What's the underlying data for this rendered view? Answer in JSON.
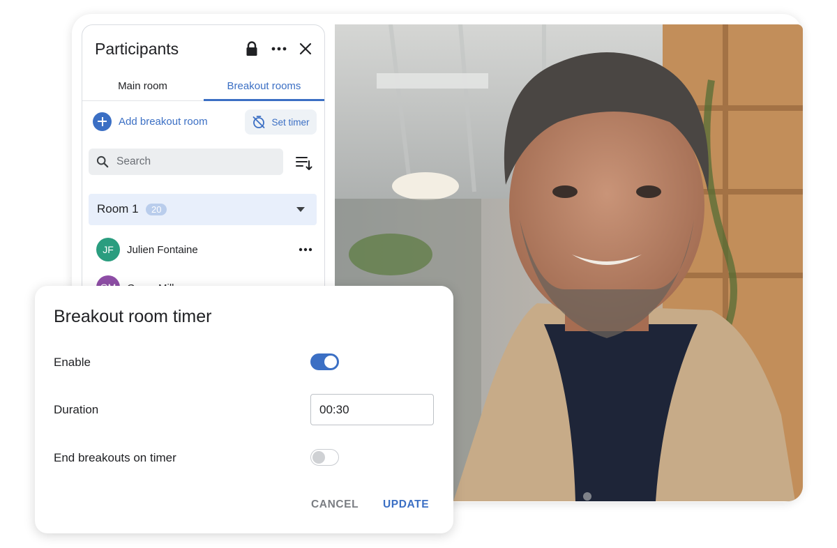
{
  "participants_panel": {
    "title": "Participants",
    "icons": {
      "lock": "lock-icon",
      "more": "more-horizontal-icon",
      "close": "close-icon"
    },
    "tabs": [
      {
        "label": "Main room",
        "active": false
      },
      {
        "label": "Breakout rooms",
        "active": true
      }
    ],
    "add_breakout_room_label": "Add breakout room",
    "set_timer_label": "Set timer",
    "search": {
      "placeholder": "Search",
      "value": ""
    },
    "room": {
      "name": "Room 1",
      "count": "20"
    },
    "participants": [
      {
        "initials": "JF",
        "name": "Julien Fontaine",
        "avatar_color": "#2a9d7f"
      },
      {
        "initials": "GM",
        "name": "Grace Miller",
        "avatar_color": "#8e4ea6"
      }
    ]
  },
  "timer_dialog": {
    "title": "Breakout room timer",
    "enable_label": "Enable",
    "enable_on": true,
    "duration_label": "Duration",
    "duration_value": "00:30",
    "end_label": "End breakouts on timer",
    "end_on": false,
    "cancel_label": "CANCEL",
    "update_label": "UPDATE"
  },
  "colors": {
    "accent": "#3b6fc4",
    "room_highlight": "#e8effb",
    "badge": "#b9cdec"
  }
}
